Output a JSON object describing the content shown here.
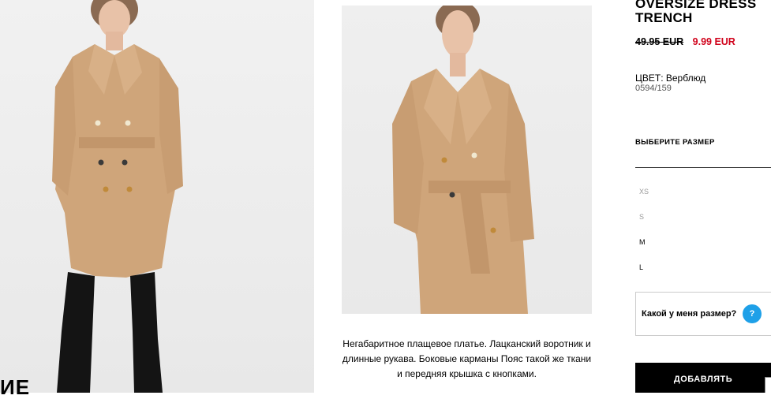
{
  "product": {
    "title": "OVERSIZE DRESS TRENCH",
    "price_old": "49.95 EUR",
    "price_new": "9.99 EUR",
    "color_label": "ЦВЕТ: Верблюд",
    "reference": "0594/159",
    "description": "Негабаритное плащевое платье. Лацканский воротник и длинные рукава. Боковые карманы Пояс такой же ткани и передняя крышка с кнопками."
  },
  "left_caption": "ИЕ",
  "sizes": {
    "heading": "ВЫБЕРИТЕ РАЗМЕР",
    "options": [
      {
        "label": "XS",
        "available": false
      },
      {
        "label": "S",
        "available": false
      },
      {
        "label": "M",
        "available": true
      },
      {
        "label": "L",
        "available": true
      }
    ],
    "help_text": "Какой у меня размер?",
    "help_icon": "question-icon",
    "help_icon_glyph": "?"
  },
  "actions": {
    "add_label": "ДОБАВЛЯТЬ"
  },
  "colors": {
    "sale_price": "#d0021b",
    "help_icon_bg": "#1ea0e8",
    "coat": "#cfa57a",
    "button_bg": "#000000"
  }
}
